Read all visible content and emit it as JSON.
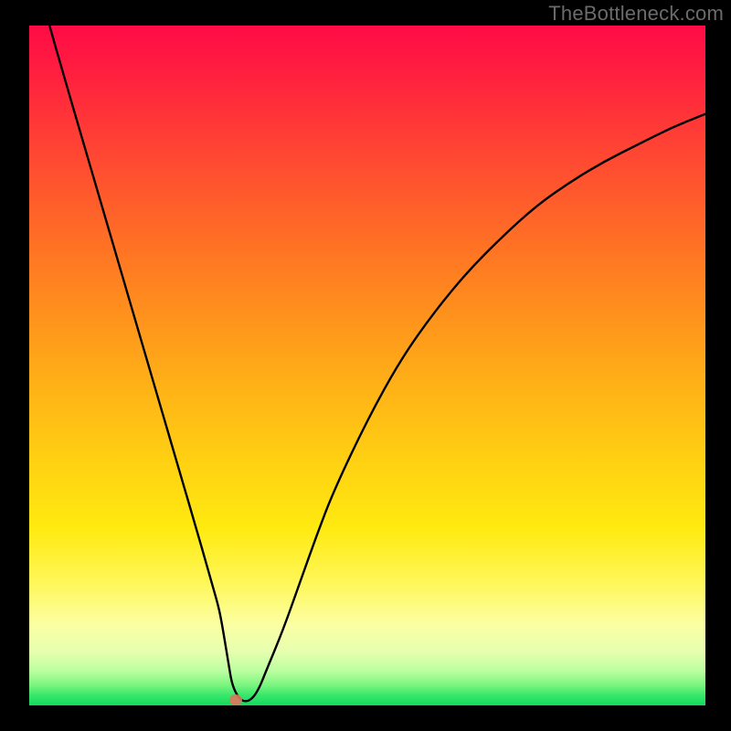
{
  "watermark": "TheBottleneck.com",
  "chart_data": {
    "type": "line",
    "title": "",
    "xlabel": "",
    "ylabel": "",
    "xlim": [
      0,
      100
    ],
    "ylim": [
      0,
      100
    ],
    "x": [
      3,
      5,
      7.5,
      10,
      12.5,
      15,
      17.5,
      20,
      22.5,
      25,
      26,
      27,
      28,
      28.5,
      29,
      29.5,
      30,
      31,
      32,
      33,
      34,
      35,
      37.5,
      40,
      42.5,
      45,
      50,
      55,
      60,
      65,
      70,
      75,
      80,
      85,
      90,
      95,
      100
    ],
    "y": [
      100,
      93,
      84.5,
      76,
      67.5,
      59,
      50.5,
      42,
      33.5,
      25,
      21.5,
      18,
      14.5,
      12,
      9,
      6,
      3,
      1,
      0.5,
      1,
      2.5,
      5,
      11,
      18,
      25,
      31.5,
      42,
      51,
      58,
      64,
      69,
      73.5,
      77,
      80,
      82.5,
      85,
      87
    ],
    "marker": {
      "x": 30.5,
      "y": 0.8
    },
    "background_gradient": {
      "orientation": "vertical",
      "stops": [
        {
          "pos": 0.0,
          "color": "#ff0b46"
        },
        {
          "pos": 0.25,
          "color": "#ff5a2c"
        },
        {
          "pos": 0.5,
          "color": "#ffa818"
        },
        {
          "pos": 0.75,
          "color": "#ffea10"
        },
        {
          "pos": 0.92,
          "color": "#e7ffb0"
        },
        {
          "pos": 1.0,
          "color": "#14d95e"
        }
      ]
    }
  }
}
